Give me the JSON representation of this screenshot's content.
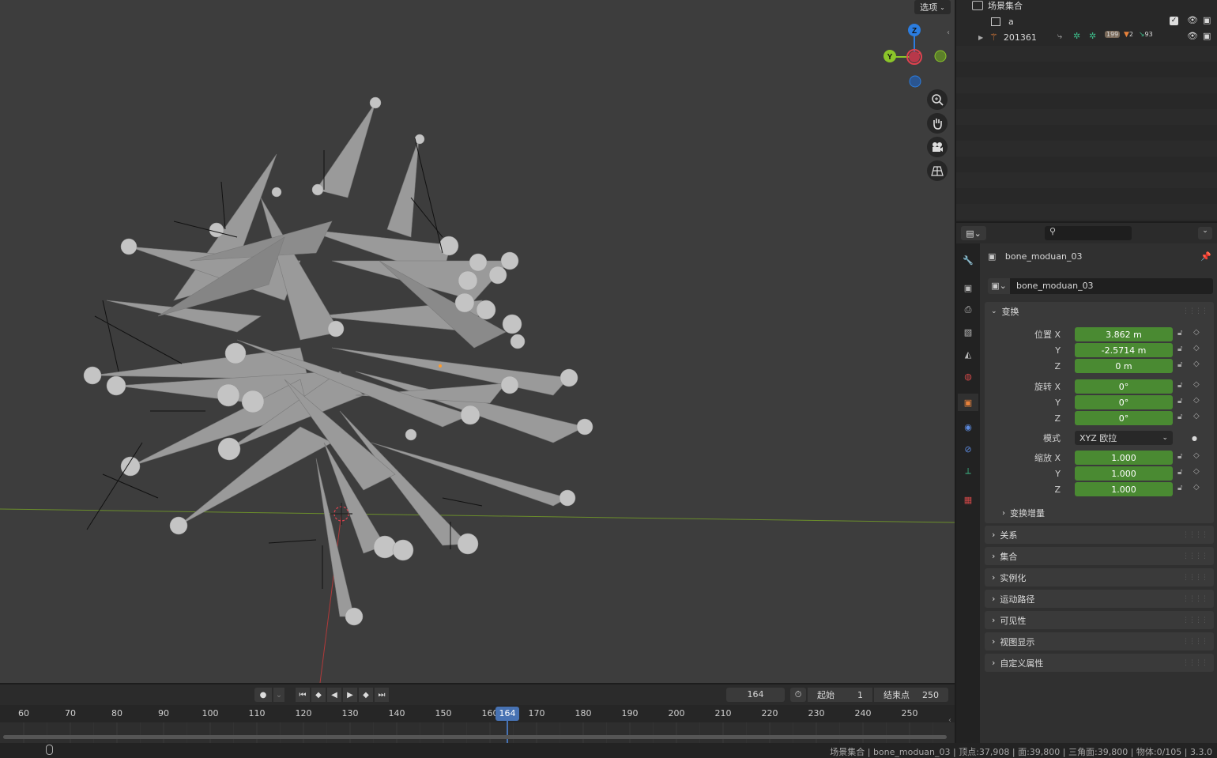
{
  "viewport": {
    "select_menu": "选项",
    "gizmo_axes": [
      "Z",
      "Y",
      "X"
    ]
  },
  "outliner": {
    "root_label": "场景集合",
    "collection_name": "a",
    "armature_name": "201361",
    "badges": [
      "199",
      "2",
      "93"
    ]
  },
  "properties": {
    "object_name": "bone_moduan_03",
    "datablock_name": "bone_moduan_03",
    "transform_header": "变换",
    "location_label": "位置 X",
    "location": [
      "3.862 m",
      "-2.5714 m",
      "0 m"
    ],
    "rotation_label": "旋转 X",
    "rotation": [
      "0°",
      "0°",
      "0°"
    ],
    "mode_label": "模式",
    "mode_value": "XYZ 欧拉",
    "scale_label": "缩放 X",
    "scale": [
      "1.000",
      "1.000",
      "1.000"
    ],
    "axis_y": "Y",
    "axis_z": "Z",
    "delta_transform": "变换增量",
    "panels": [
      "关系",
      "集合",
      "实例化",
      "运动路径",
      "可见性",
      "视图显示",
      "自定义属性"
    ]
  },
  "timeline": {
    "current_frame": "164",
    "start_label": "起始",
    "start_value": "1",
    "end_label": "结束点",
    "end_value": "250",
    "ruler_ticks": [
      "60",
      "70",
      "80",
      "90",
      "100",
      "110",
      "120",
      "130",
      "140",
      "150",
      "160",
      "170",
      "180",
      "190",
      "200",
      "210",
      "220",
      "230",
      "240",
      "250"
    ],
    "playhead": "164"
  },
  "status": {
    "text": "场景集合 | bone_moduan_03 | 顶点:37,908 | 面:39,800 | 三角面:39,800 | 物体:0/105 | 3.3.0"
  },
  "colors": {
    "accent_blue": "#4772b3",
    "field_green": "#4a8a32",
    "axis_x": "#e0424f",
    "axis_y": "#8bc42a",
    "axis_z": "#2b7de0"
  }
}
